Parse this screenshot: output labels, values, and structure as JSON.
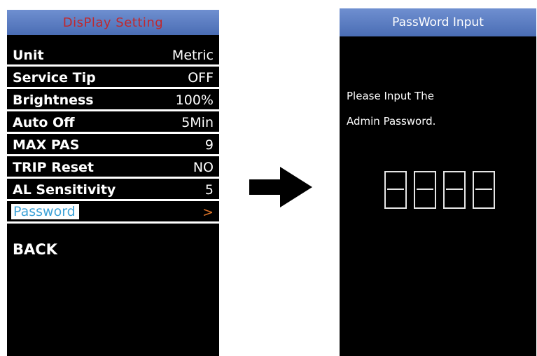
{
  "left_screen": {
    "title": "DisPlay  Setting",
    "rows": [
      {
        "label": "Unit",
        "value": "Metric"
      },
      {
        "label": "Service Tip",
        "value": "OFF"
      },
      {
        "label": "Brightness",
        "value": "100%"
      },
      {
        "label": "Auto Off",
        "value": "5Min"
      },
      {
        "label": "MAX PAS",
        "value": "9"
      },
      {
        "label": "TRIP Reset",
        "value": "NO"
      },
      {
        "label": "AL Sensitivity",
        "value": "5"
      },
      {
        "label": "Password",
        "value": ">"
      }
    ],
    "back_label": "BACK"
  },
  "right_screen": {
    "title": "PassWord Input",
    "prompt_line1": "Please Input The",
    "prompt_line2": "Admin Password."
  },
  "colors": {
    "title_bar": "#5a7cc2",
    "title_left_text": "#c0282d",
    "selected_label": "#3fa3d8",
    "selected_value": "#e0762a",
    "screen_bg": "#000000"
  }
}
